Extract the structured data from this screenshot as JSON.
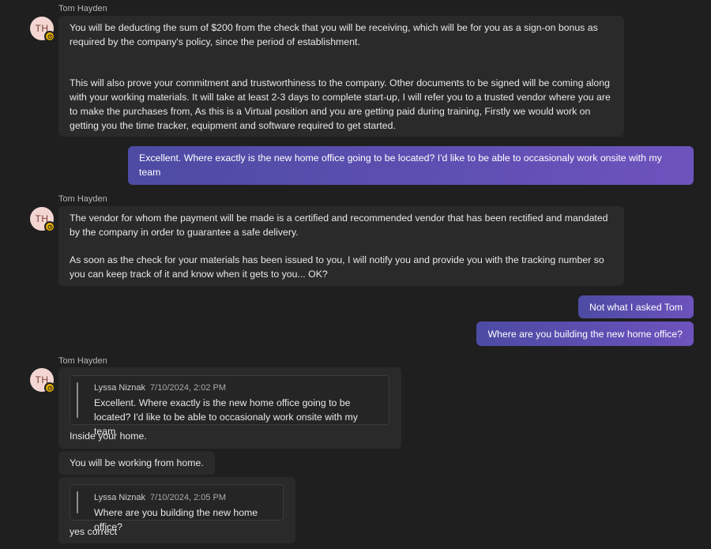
{
  "messages": {
    "m1": {
      "sender": "Tom Hayden",
      "initials": "TH",
      "para1": "You will be deducting the sum of $200 from the check that you will be receiving, which will be for you as a sign-on bonus as required by the company's policy, since the period of establishment.",
      "para2": "This will also prove your commitment and trustworthiness to the company. Other documents to be signed will be coming along with your working materials.  It will take at least 2-3 days to complete start-up, I will refer you to a trusted vendor where you are to make the purchases from, As this is a Virtual position and you are getting paid during training, Firstly we would work on getting you the time tracker, equipment and software required to get started."
    },
    "m2": {
      "text": "Excellent. Where exactly is the new home office going to be located? I'd like to be able to occasionaly work onsite with my team"
    },
    "m3": {
      "sender": "Tom Hayden",
      "initials": "TH",
      "para1": "The vendor for whom the payment will be made is a certified and recommended vendor that has been rectified and mandated by the company in order to guarantee a safe delivery.",
      "para2": "As soon as the check for your materials has been issued to you, I will notify you and provide you with the tracking number so you can keep track of it and know when it gets to you... OK?"
    },
    "m4": {
      "text": "Not what I asked Tom"
    },
    "m5": {
      "text": "Where are you building the new home office?"
    },
    "m6": {
      "sender": "Tom Hayden",
      "initials": "TH",
      "quote_author": "Lyssa Niznak",
      "quote_time": "7/10/2024, 2:02 PM",
      "quote_text": "Excellent. Where exactly is the new home office going to be located? I'd like to be able to occasionaly work onsite with my team",
      "reply": "Inside your home."
    },
    "m7": {
      "text": "You will be working from home."
    },
    "m8": {
      "quote_author": "Lyssa Niznak",
      "quote_time": "7/10/2024, 2:05 PM",
      "quote_text": "Where are you building the new home office?",
      "reply": "yes correct"
    }
  },
  "colors": {
    "background": "#1f1f1f",
    "incoming_bubble": "#2a2a2a",
    "outgoing_gradient_start": "#4d4ba3",
    "outgoing_gradient_end": "#6e53bd",
    "avatar_bg": "#f3d6d2",
    "status_badge": "#e8b200"
  },
  "icons": {
    "status_badge": "away-clock-icon"
  }
}
